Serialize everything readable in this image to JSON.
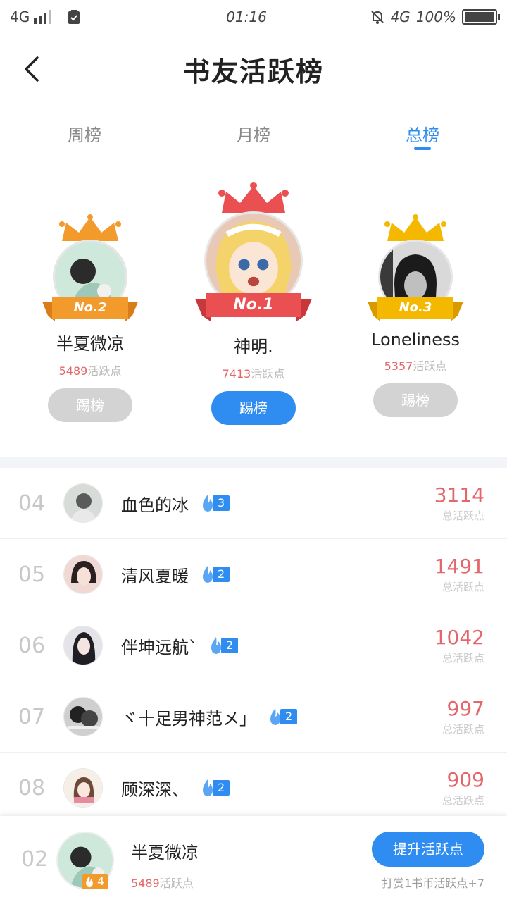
{
  "status_bar": {
    "network_left": "4G",
    "time": "01:16",
    "network_right": "4G",
    "battery": "100%",
    "battery_level": 1.0
  },
  "header": {
    "title": "书友活跃榜"
  },
  "tabs": [
    {
      "label": "周榜",
      "active": false
    },
    {
      "label": "月榜",
      "active": false
    },
    {
      "label": "总榜",
      "active": true
    }
  ],
  "podium": {
    "first": {
      "rank_label": "No.1",
      "name": "神明.",
      "points": "7413",
      "points_suffix": "活跃点",
      "button": "踢榜"
    },
    "second": {
      "rank_label": "No.2",
      "name": "半夏微凉",
      "points": "5489",
      "points_suffix": "活跃点",
      "button": "踢榜"
    },
    "third": {
      "rank_label": "No.3",
      "name": "Loneliness",
      "points": "5357",
      "points_suffix": "活跃点",
      "button": "踢榜"
    }
  },
  "ranking": [
    {
      "rank": "04",
      "name": "血色的冰",
      "level": "3",
      "score": "3114",
      "score_label": "总活跃点"
    },
    {
      "rank": "05",
      "name": "清风夏暖",
      "level": "2",
      "score": "1491",
      "score_label": "总活跃点"
    },
    {
      "rank": "06",
      "name": "伴坤远航`",
      "level": "2",
      "score": "1042",
      "score_label": "总活跃点"
    },
    {
      "rank": "07",
      "name": "ヾ十足男神范メ」",
      "level": "2",
      "score": "997",
      "score_label": "总活跃点"
    },
    {
      "rank": "08",
      "name": "顾深深、",
      "level": "2",
      "score": "909",
      "score_label": "总活跃点"
    }
  ],
  "me": {
    "rank": "02",
    "level": "4",
    "name": "半夏微凉",
    "points": "5489",
    "points_suffix": "活跃点",
    "boost_button": "提升活跃点",
    "boost_tip": "打赏1书币活跃点+7"
  },
  "colors": {
    "accent": "#2f8cf0",
    "score_red": "#e4666a",
    "gold": "#f5b800",
    "silver_orange": "#f39a2c",
    "first_red": "#ea4f52"
  }
}
